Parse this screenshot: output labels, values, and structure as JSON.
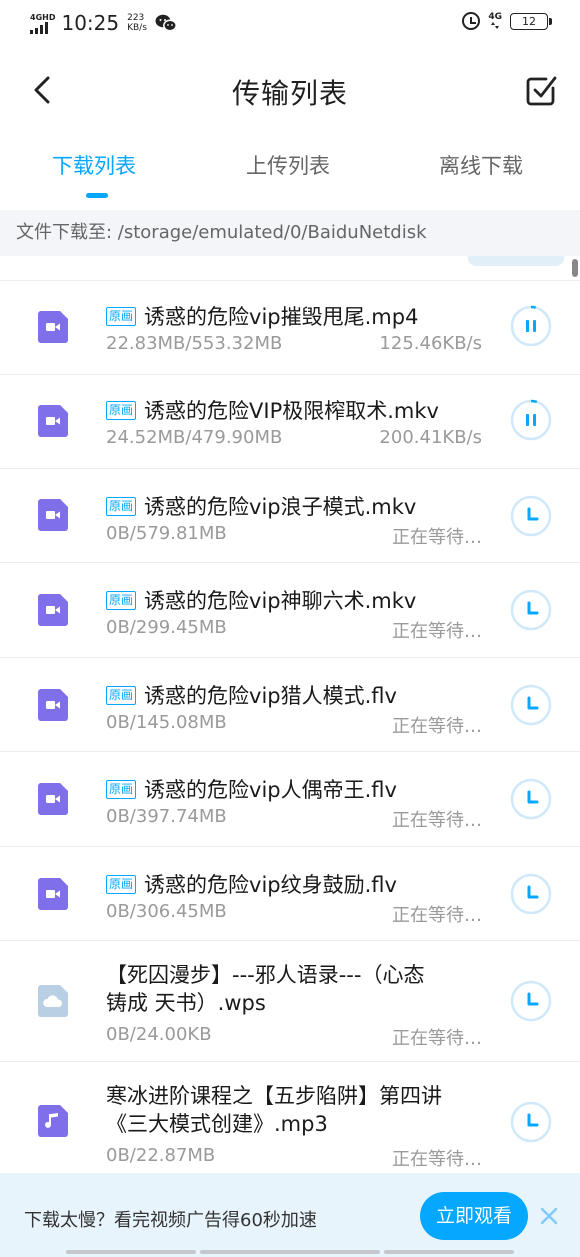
{
  "status_bar": {
    "network_label": "4GHD",
    "time": "10:25",
    "speed_value": "223",
    "speed_unit": "KB/s",
    "mobile_label": "4G",
    "battery": "12"
  },
  "header": {
    "title": "传输列表"
  },
  "tabs": [
    {
      "label": "下载列表",
      "active": true
    },
    {
      "label": "上传列表",
      "active": false
    },
    {
      "label": "离线下载",
      "active": false
    }
  ],
  "path": {
    "text": "文件下载至: /storage/emulated/0/BaiduNetdisk"
  },
  "accent_color": "#06a7ff",
  "video_icon_color": "#7f6fe8",
  "files": [
    {
      "badge": "原画",
      "name": "诱惑的危险vip摧毁甩尾.mp4",
      "size": "22.83MB/553.32MB",
      "status": "125.46KB/s",
      "icon": "video-file-icon",
      "action": "pause",
      "progress": 0.04
    },
    {
      "badge": "原画",
      "name": "诱惑的危险VIP极限榨取术.mkv",
      "size": "24.52MB/479.90MB",
      "status": "200.41KB/s",
      "icon": "video-file-icon",
      "action": "pause",
      "progress": 0.05
    },
    {
      "badge": "原画",
      "name": "诱惑的危险vip浪子模式.mkv",
      "size": "0B/579.81MB",
      "status": "正在等待…",
      "icon": "video-file-icon",
      "action": "waiting"
    },
    {
      "badge": "原画",
      "name": "诱惑的危险vip神聊六术.mkv",
      "size": "0B/299.45MB",
      "status": "正在等待…",
      "icon": "video-file-icon",
      "action": "waiting"
    },
    {
      "badge": "原画",
      "name": "诱惑的危险vip猎人模式.flv",
      "size": "0B/145.08MB",
      "status": "正在等待…",
      "icon": "video-file-icon",
      "action": "waiting"
    },
    {
      "badge": "原画",
      "name": "诱惑的危险vip人偶帝王.flv",
      "size": "0B/397.74MB",
      "status": "正在等待…",
      "icon": "video-file-icon",
      "action": "waiting"
    },
    {
      "badge": "原画",
      "name": "诱惑的危险vip纹身鼓励.flv",
      "size": "0B/306.45MB",
      "status": "正在等待…",
      "icon": "video-file-icon",
      "action": "waiting"
    },
    {
      "name_line1": "【死囚漫步】---邪人语录---（心态",
      "name_line2": "铸成 天书）.wps",
      "size": "0B/24.00KB",
      "status": "正在等待…",
      "icon": "cloud-file-icon",
      "action": "waiting"
    },
    {
      "name_line1": "寒冰进阶课程之【五步陷阱】第四讲",
      "name_line2": "《三大模式创建》.mp3",
      "size": "0B/22.87MB",
      "status": "正在等待…",
      "icon": "audio-file-icon",
      "action": "waiting"
    }
  ],
  "ad": {
    "text": "下载太慢？看完视频广告得60秒加速",
    "button": "立即观看"
  }
}
